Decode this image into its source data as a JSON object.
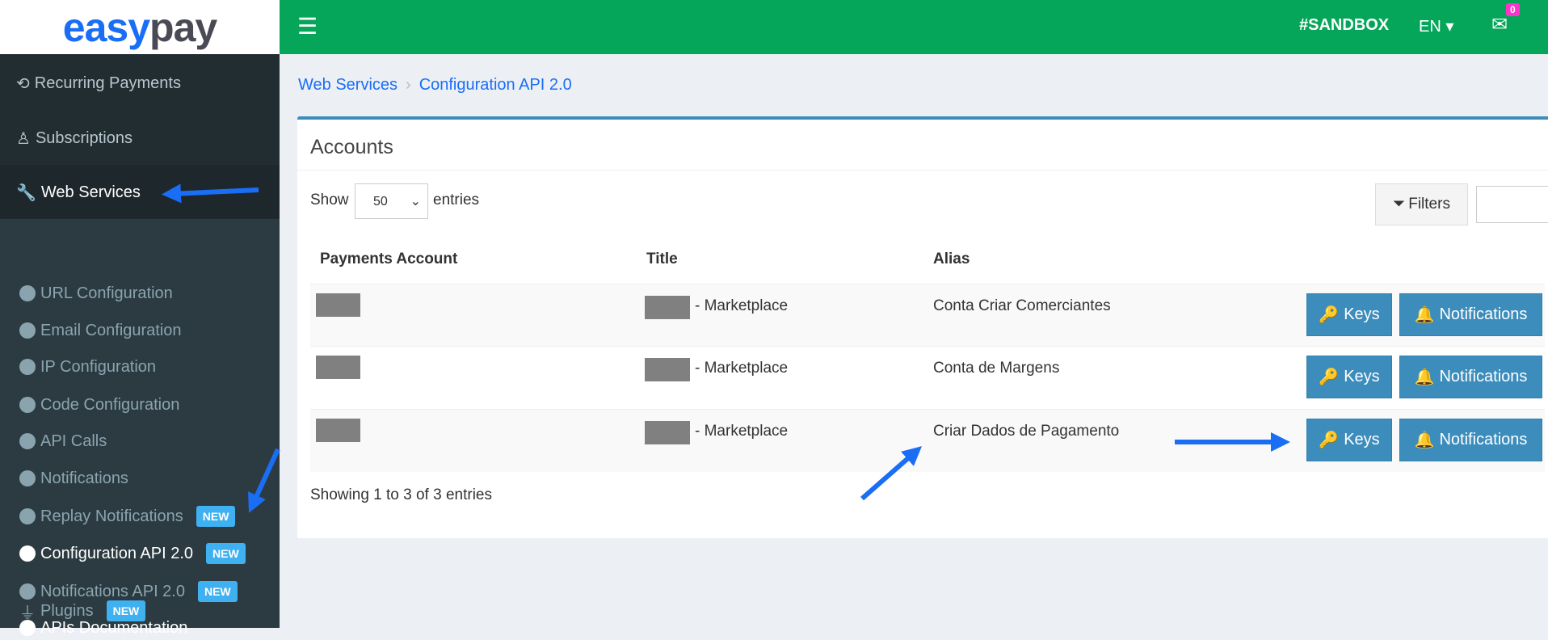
{
  "brand": {
    "logo": "easypay",
    "colors": {
      "topbar": "#06a65a",
      "sidebar": "#222d32",
      "accent": "#3c8dbc",
      "badge": "#3fb0f0",
      "notify": "#ff33cc"
    }
  },
  "topbar": {
    "menu_icon": "hamburger-icon",
    "env": "#SANDBOX",
    "lang": "EN",
    "mail_count": "0"
  },
  "sidebar": {
    "main": [
      {
        "label": "Recurring Payments",
        "icon": "history-icon"
      },
      {
        "label": "Subscriptions",
        "icon": "person-icon"
      },
      {
        "label": "Web Services",
        "icon": "wrench-icon"
      }
    ],
    "sub": [
      {
        "label": "URL Configuration"
      },
      {
        "label": "Email Configuration"
      },
      {
        "label": "IP Configuration"
      },
      {
        "label": "Code Configuration"
      },
      {
        "label": "API Calls"
      },
      {
        "label": "Notifications"
      },
      {
        "label": "Replay Notifications",
        "badge": "NEW"
      },
      {
        "label": "Configuration API 2.0",
        "badge": "NEW",
        "active": true
      },
      {
        "label": "Notifications API 2.0",
        "badge": "NEW"
      },
      {
        "label": "APIs Documentation",
        "active": true
      }
    ],
    "plugins": {
      "label": "Plugins",
      "badge": "NEW"
    }
  },
  "breadcrumb": [
    "Web Services",
    "Configuration API 2.0"
  ],
  "box": {
    "title": "Accounts",
    "show": "Show",
    "entries": "entries",
    "page_size": "50",
    "filters": "Filters",
    "search_value": "",
    "columns": [
      "Payments Account",
      "Title",
      "Alias"
    ],
    "rows": [
      {
        "title": "- Marketplace",
        "alias": "Conta Criar Comerciantes"
      },
      {
        "title": "- Marketplace",
        "alias": "Conta de Margens"
      },
      {
        "title": "- Marketplace",
        "alias": "Criar Dados de Pagamento"
      }
    ],
    "keys": "Keys",
    "notifications": "Notifications",
    "info": "Showing 1 to 3 of 3 entries"
  }
}
